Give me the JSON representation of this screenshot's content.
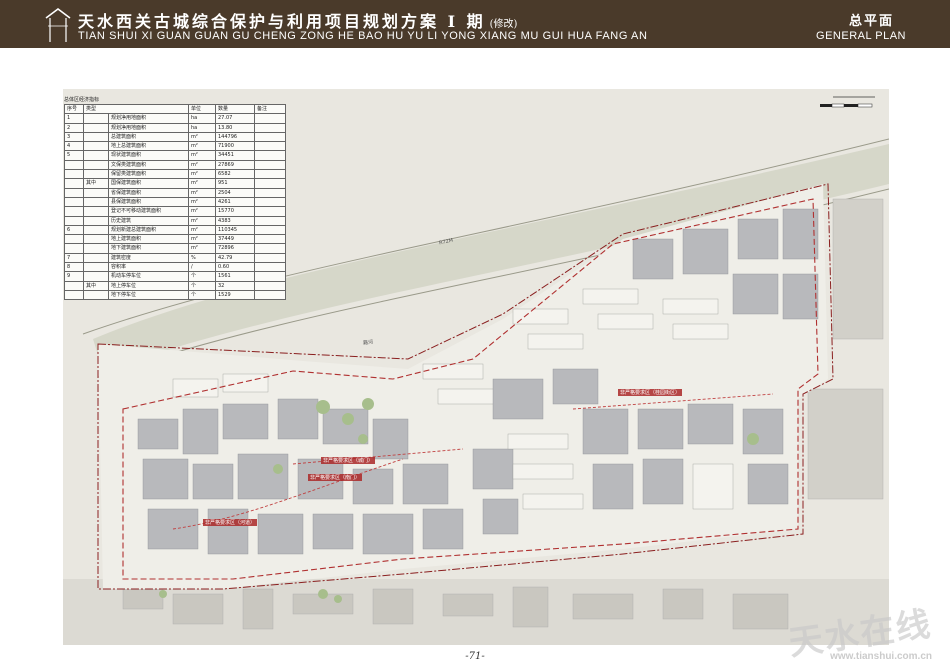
{
  "header": {
    "title_cn": "天水西关古城综合保护与利用项目规划方案 I 期",
    "title_rev": "(修改)",
    "title_en": "TIAN SHUI XI GUAN GUAN GU CHENG ZONG HE BAO HU YU LI YONG XIANG MU GUI HUA FANG AN",
    "plan_cn": "总平面",
    "plan_en": "GENERAL PLAN"
  },
  "econ": {
    "caption": "总体区经济指标",
    "head": [
      "序号",
      "类型",
      "单位",
      "数量",
      "备注"
    ],
    "rows": [
      {
        "no": "1",
        "sub": "",
        "name": "规划净用地面积",
        "unit": "ha",
        "value": "27.07"
      },
      {
        "no": "2",
        "sub": "",
        "name": "规划净用地面积",
        "unit": "ha",
        "value": "13.80"
      },
      {
        "no": "3",
        "sub": "",
        "name": "总建筑面积",
        "unit": "m²",
        "value": "144796"
      },
      {
        "no": "4",
        "sub": "",
        "name": "地上总建筑面积",
        "unit": "m²",
        "value": "71900"
      },
      {
        "no": "5",
        "sub": "",
        "name": "现状建筑面积",
        "unit": "m²",
        "value": "34451"
      },
      {
        "no": "",
        "sub": "",
        "name": "文保类建筑面积",
        "unit": "m²",
        "value": "27869"
      },
      {
        "no": "",
        "sub": "",
        "name": "保留类建筑面积",
        "unit": "m²",
        "value": "6582"
      },
      {
        "no": "",
        "sub": "其中",
        "name": "国保建筑面积",
        "unit": "m²",
        "value": "951"
      },
      {
        "no": "",
        "sub": "",
        "name": "省保建筑面积",
        "unit": "m²",
        "value": "2504"
      },
      {
        "no": "",
        "sub": "",
        "name": "县保建筑面积",
        "unit": "m²",
        "value": "4261"
      },
      {
        "no": "",
        "sub": "",
        "name": "登记不可移动建筑面积",
        "unit": "m²",
        "value": "15770"
      },
      {
        "no": "",
        "sub": "",
        "name": "历史建筑",
        "unit": "m²",
        "value": "4383"
      },
      {
        "no": "6",
        "sub": "",
        "name": "规划新建总建筑面积",
        "unit": "m²",
        "value": "110345"
      },
      {
        "no": "",
        "sub": "",
        "name": "地上建筑面积",
        "unit": "m²",
        "value": "37449"
      },
      {
        "no": "",
        "sub": "",
        "name": "地下建筑面积",
        "unit": "m²",
        "value": "72896"
      },
      {
        "no": "7",
        "sub": "",
        "name": "建筑密度",
        "unit": "%",
        "value": "42.79"
      },
      {
        "no": "8",
        "sub": "",
        "name": "容积率",
        "unit": "/",
        "value": "0.60"
      },
      {
        "no": "9",
        "sub": "",
        "name": "机动车停车位",
        "unit": "个",
        "value": "1561"
      },
      {
        "no": "",
        "sub": "其中",
        "name": "地上停车位",
        "unit": "个",
        "value": "32"
      },
      {
        "no": "",
        "sub": "",
        "name": "地下停车位",
        "unit": "个",
        "value": "1529"
      }
    ]
  },
  "map": {
    "labels": [
      "非严格要求区（城门）",
      "非严格要求区（河道）",
      "非严格要求区（南门）",
      "非严格要求区（桂园街区）"
    ],
    "roads": [
      "R72M",
      "藉河"
    ]
  },
  "footer": {
    "page_number": "-71-"
  },
  "watermark": {
    "cn": "天水在线",
    "en": "www.tianshui.com.cn"
  }
}
